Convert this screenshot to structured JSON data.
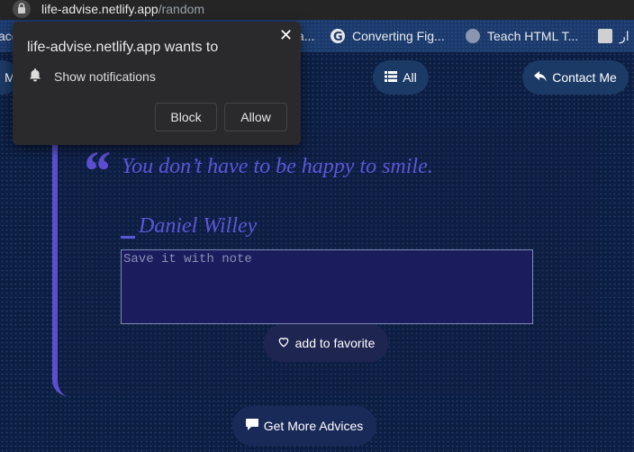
{
  "browser": {
    "url_host": "life-advise.netlify.app",
    "url_path": "/random",
    "bookmarks": [
      {
        "label": "ace"
      },
      {
        "label": "a..."
      },
      {
        "label": "Converting Fig..."
      },
      {
        "label": "Teach HTML T..."
      },
      {
        "label": "ار"
      }
    ]
  },
  "popup": {
    "title": "life-advise.netlify.app wants to",
    "permission": "Show notifications",
    "block_label": "Block",
    "allow_label": "Allow",
    "close_glyph": "✕"
  },
  "nav": {
    "left_partial_label": "M",
    "all_label": "All",
    "contact_label": "Contact Me"
  },
  "quote": {
    "mark": "“",
    "text": "You don’t have to be happy to smile.",
    "author": "Daniel Willey"
  },
  "note": {
    "placeholder": "Save it with note",
    "value": ""
  },
  "actions": {
    "favorite_label": "add to favorite",
    "more_label": "Get More Advices"
  },
  "colors": {
    "accent": "#5b4fd0",
    "background": "#0c1e42",
    "pill": "#1c3a66"
  }
}
